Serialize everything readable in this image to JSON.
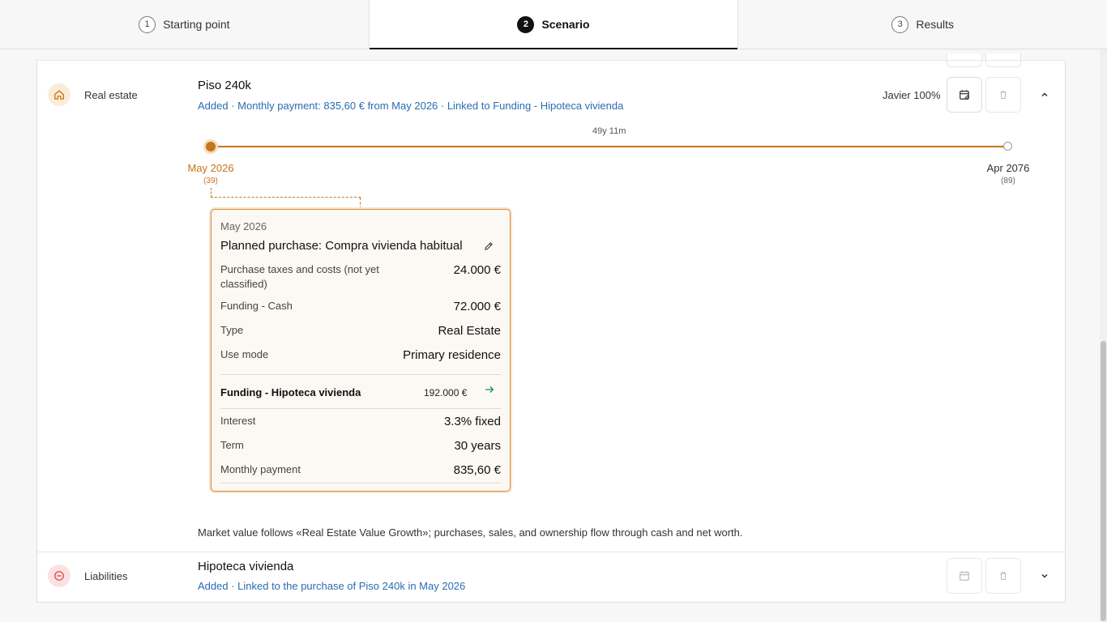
{
  "stepper": {
    "steps": [
      {
        "num": "1",
        "label": "Starting point"
      },
      {
        "num": "2",
        "label": "Scenario"
      },
      {
        "num": "3",
        "label": "Results"
      }
    ],
    "active_index": 1
  },
  "real_estate_row": {
    "category": "Real estate",
    "title": "Piso 240k",
    "subtitle": "Added · Monthly payment: 835,60 € from May 2026 · Linked to Funding - Hipoteca vivienda",
    "owner": "Javier 100%",
    "timeline": {
      "duration": "49y 11m",
      "start_date": "May 2026",
      "start_age": "(39)",
      "end_date": "Apr 2076",
      "end_age": "(89)"
    },
    "event_card": {
      "date": "May 2026",
      "title": "Planned purchase: Compra vivienda habitual",
      "rows": [
        {
          "label": "Purchase taxes and costs (not yet classified)",
          "value": "24.000 €"
        },
        {
          "label": "Funding - Cash",
          "value": "72.000 €"
        },
        {
          "label": "Type",
          "value": "Real Estate"
        },
        {
          "label": "Use mode",
          "value": "Primary residence"
        }
      ],
      "funding": {
        "title": "Funding - Hipoteca vivienda",
        "amount": "192.000 €",
        "rows": [
          {
            "label": "Interest",
            "value": "3.3% fixed"
          },
          {
            "label": "Term",
            "value": "30 years"
          },
          {
            "label": "Monthly payment",
            "value": "835,60 €"
          }
        ]
      }
    },
    "footnote": "Market value follows «Real Estate Value Growth»; purchases, sales, and ownership flow through cash and net worth."
  },
  "liabilities_row": {
    "category": "Liabilities",
    "title": "Hipoteca vivienda",
    "subtitle": "Added · Linked to the purchase of Piso 240k in May 2026"
  },
  "colors": {
    "accent": "#c8741c",
    "link": "#2b6cb0",
    "liability": "#d94a4a"
  }
}
